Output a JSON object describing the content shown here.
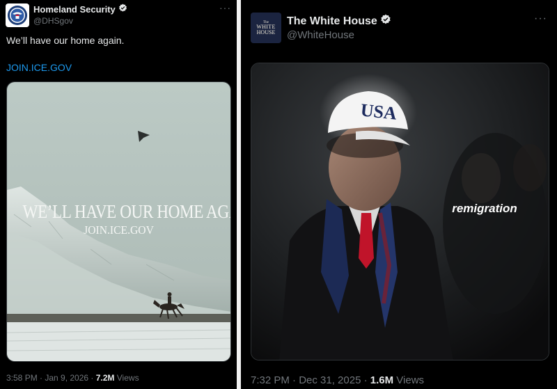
{
  "posts": {
    "left": {
      "author_name": "Homeland Security",
      "handle": "@DHSgov",
      "avatar_icon": "dhs-seal-icon",
      "verified": true,
      "text": "We’ll have our home again.",
      "link": "JOIN.ICE.GOV",
      "image": {
        "headline": "WE’LL HAVE OUR HOME AGAIN",
        "url_text": "JOIN.ICE.GOV"
      },
      "meta": {
        "time_date": "3:58 PM · Jan 9, 2026 · ",
        "views_count": "7.2M",
        "views_label": " Views"
      }
    },
    "right": {
      "author_name": "The White House",
      "handle": "@WhiteHouse",
      "avatar": {
        "small": "The",
        "line1": "WHITE",
        "line2": "HOUSE"
      },
      "verified": true,
      "image": {
        "cap_text": "USA",
        "caption": "remigration"
      },
      "meta": {
        "time_date": "7:32 PM · Dec 31, 2025 · ",
        "views_count": "1.6M",
        "views_label": " Views"
      }
    }
  },
  "colors": {
    "background": "#000000",
    "text_primary": "#e7e9ea",
    "text_secondary": "#71767b",
    "link": "#1d9bf0",
    "verified_badge": "#e7e9ea"
  }
}
